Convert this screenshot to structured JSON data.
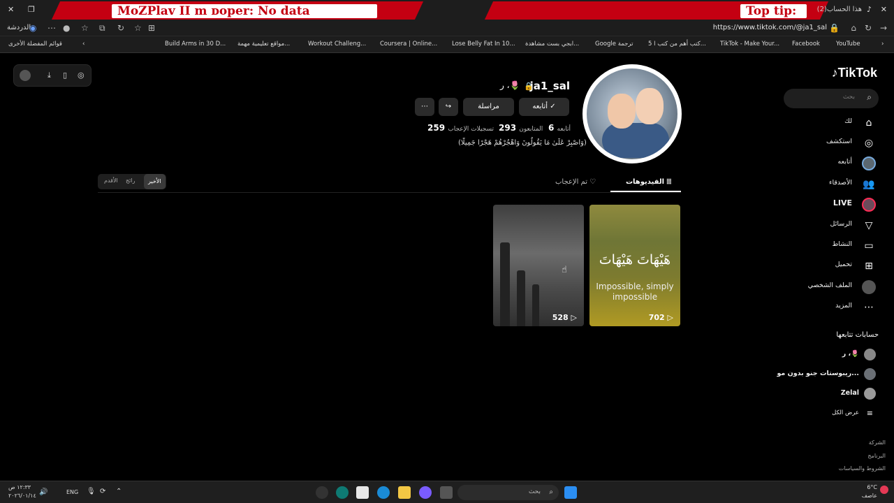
{
  "browser": {
    "banner_left": "MoZPlav   II m    ᴅoper: No data",
    "banner_right": "Top tip:",
    "tab_title": "(2)هذا الحساب",
    "url": "https://www.tiktok.com/@ja1_sal",
    "chat_label": "الدردشة",
    "bookmarks": [
      {
        "label": "قوائم المفضلة الأخرى"
      },
      {
        "label": "Build Arms in 30 D..."
      },
      {
        "label": "مواقع تعليمية مهمة..."
      },
      {
        "label": "Workout Challeng..."
      },
      {
        "label": "Coursera | Online..."
      },
      {
        "label": "Lose Belly Fat In 10..."
      },
      {
        "label": "ابجي بست مشاهدة..."
      },
      {
        "label": "Google ترجمة"
      },
      {
        "label": "5 كتب أهم من كتب ا..."
      },
      {
        "label": "TikTok - Make Your..."
      },
      {
        "label": "Facebook"
      },
      {
        "label": "YouTube"
      }
    ]
  },
  "sidebar": {
    "logo": "TikTok",
    "search_placeholder": "بحث",
    "nav": [
      {
        "label": "لك",
        "icon": "home-icon"
      },
      {
        "label": "استكشف",
        "icon": "compass-icon"
      },
      {
        "label": "أتابعه",
        "icon": "following-avatar-icon"
      },
      {
        "label": "الأصدقاء",
        "icon": "friends-icon"
      },
      {
        "label": "LIVE",
        "icon": "live-icon"
      },
      {
        "label": "الرسائل",
        "icon": "send-icon"
      },
      {
        "label": "النشاط",
        "icon": "activity-icon"
      },
      {
        "label": "تحميل",
        "icon": "upload-icon"
      },
      {
        "label": "الملف الشخصي",
        "icon": "profile-icon"
      },
      {
        "label": "المزيد",
        "icon": "more-icon"
      }
    ],
    "following_title": "حسابات تتابعها",
    "following": [
      {
        "label": "ر ،🌷"
      },
      {
        "label": "ريبوستات جنو بدون مو..."
      },
      {
        "label": "Zelal"
      }
    ],
    "see_all": "عرض الكل",
    "footer": [
      "الشركة",
      "البرنامج",
      "الشروط والسياسات"
    ]
  },
  "profile": {
    "username": "ja1_sal",
    "nickname": "ر ،🌷",
    "follow_label": "أتابعه",
    "message_label": "مراسلة",
    "stats": {
      "following_count": "6",
      "following_label": "أتابعه",
      "followers_count": "293",
      "followers_label": "المتابعون",
      "likes_count": "259",
      "likes_label": "تسجيلات الإعجاب"
    },
    "bio": "(وَاصْبِرْ عَلَىٰ مَا يَقُولُونَ وَاهْجُرْهُمْ هَجْرًا جَمِيلًا)"
  },
  "tabs": {
    "videos": "الفيديوهات",
    "liked": "تم الإعجاب"
  },
  "sort": {
    "latest": "الأخير",
    "popular": "رائج",
    "oldest": "الأقدم"
  },
  "videos": [
    {
      "title_ar": "هَيْهَاتَ هَيْهَاتَ",
      "title_en": "Impossible, simply impossible",
      "views": "702"
    },
    {
      "title_ar": "",
      "title_en": "",
      "views": "528"
    }
  ],
  "taskbar": {
    "search_placeholder": "بحث",
    "lang": "ENG",
    "time": "١٢:٣٣ ص",
    "date": "٢٠٢٦/٠١/١٤",
    "weather_temp": "6°C",
    "weather_desc": "عاصف"
  },
  "colors": {
    "banner": "#c40012",
    "background": "#000000",
    "accent_live": "#fe2c55"
  }
}
